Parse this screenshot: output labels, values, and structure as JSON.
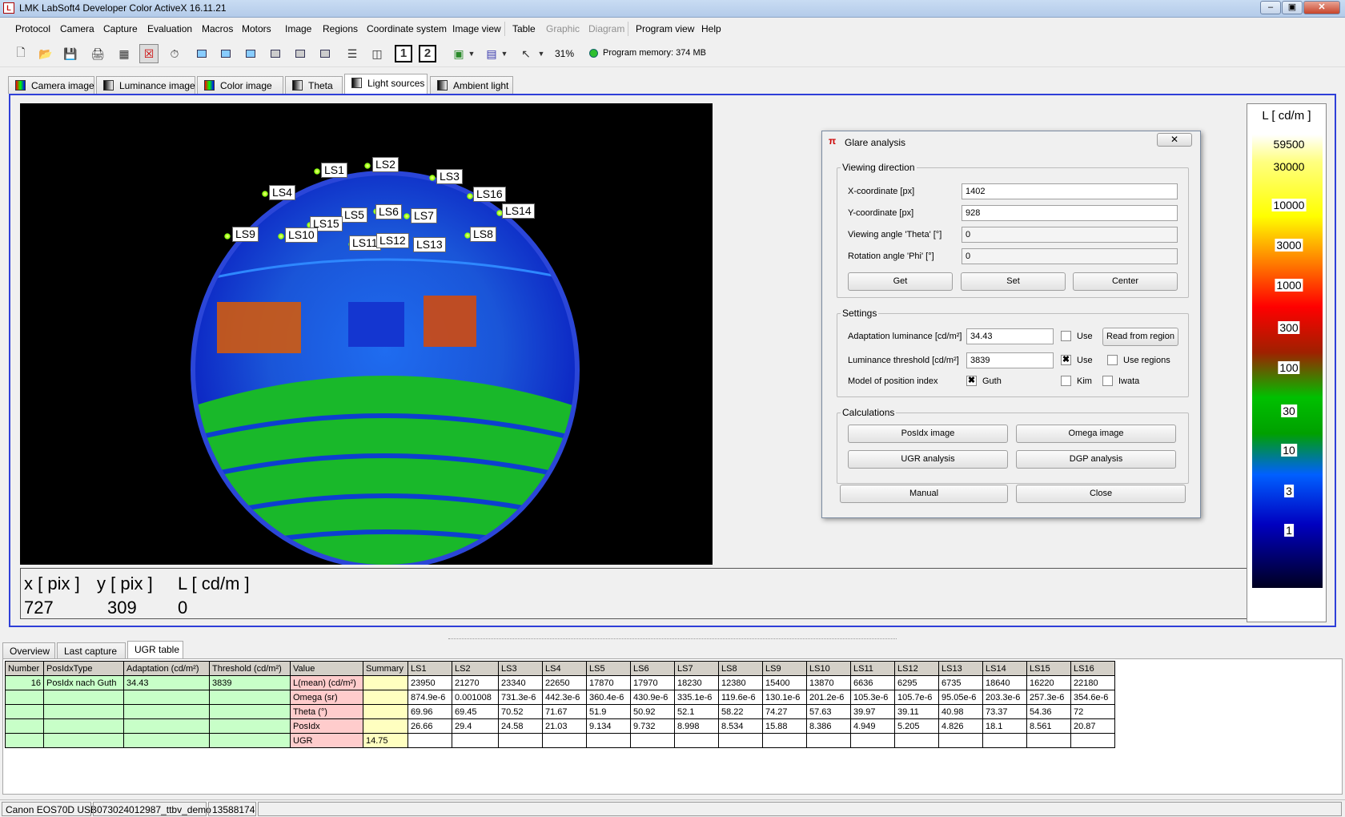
{
  "window": {
    "title": "LMK LabSoft4 Developer Color ActiveX  16.11.21",
    "minimize": "–",
    "restore": "▣",
    "close": "✕"
  },
  "menu": [
    "Protocol",
    "Camera",
    "Capture",
    "Evaluation",
    "Macros",
    "Motors",
    "Image",
    "Regions",
    "Coordinate system",
    "Image view",
    "Table",
    "Graphic",
    "Diagram",
    "Program view",
    "Help"
  ],
  "toolbar": {
    "zoom": "31%",
    "memory": "Program memory: 374 MB",
    "num1": "1",
    "num2": "2"
  },
  "image_tabs": [
    "Camera image",
    "Luminance image",
    "Color image",
    "Theta",
    "Light sources",
    "Ambient light"
  ],
  "light_sources": [
    "LS1",
    "LS2",
    "LS3",
    "LS4",
    "LS16",
    "LS14",
    "LS5",
    "LS6",
    "LS7",
    "LS15",
    "LS9",
    "LS10",
    "LS8",
    "LS11",
    "LS12",
    "LS13"
  ],
  "coords": {
    "x_label": "x [ pix ]",
    "y_label": "y [ pix ]",
    "l_label": "L [ cd/m ]",
    "x": "727",
    "y": "309",
    "l": "0"
  },
  "legend": {
    "title": "L [ cd/m ]",
    "ticks": [
      "59500",
      "30000",
      "10000",
      "3000",
      "1000",
      "300",
      "100",
      "30",
      "10",
      "3",
      "1"
    ]
  },
  "dialog": {
    "title": "Glare analysis",
    "close_x": "✕",
    "viewing_group": "Viewing direction",
    "x_label": "X-coordinate [px]",
    "x_value": "1402",
    "y_label": "Y-coordinate [px]",
    "y_value": "928",
    "theta_label": "Viewing angle 'Theta' [°]",
    "theta_value": "0",
    "phi_label": "Rotation angle 'Phi' [°]",
    "phi_value": "0",
    "get": "Get",
    "set": "Set",
    "center": "Center",
    "settings_group": "Settings",
    "adapt_label": "Adaptation luminance [cd/m²]",
    "adapt_value": "34.43",
    "use1": "Use",
    "read_region": "Read from region",
    "thresh_label": "Luminance threshold [cd/m²]",
    "thresh_value": "3839",
    "use2": "Use",
    "use_regions": "Use regions",
    "model_label": "Model of position index",
    "guth": "Guth",
    "kim": "Kim",
    "iwata": "Iwata",
    "calc_group": "Calculations",
    "posidx_img": "PosIdx image",
    "omega_img": "Omega image",
    "ugr_analysis": "UGR analysis",
    "dgp_analysis": "DGP analysis",
    "manual": "Manual",
    "close": "Close"
  },
  "bottom_tabs": [
    "Overview",
    "Last capture",
    "UGR table"
  ],
  "ugr_table": {
    "headers": [
      "Number",
      "PosIdxType",
      "Adaptation (cd/m²)",
      "Threshold (cd/m²)",
      "Value",
      "Summary",
      "LS1",
      "LS2",
      "LS3",
      "LS4",
      "LS5",
      "LS6",
      "LS7",
      "LS8",
      "LS9",
      "LS10",
      "LS11",
      "LS12",
      "LS13",
      "LS14",
      "LS15",
      "LS16"
    ],
    "rows": [
      [
        "16",
        "PosIdx nach Guth",
        "34.43",
        "3839",
        "L(mean) (cd/m²)",
        "",
        "23950",
        "21270",
        "23340",
        "22650",
        "17870",
        "17970",
        "18230",
        "12380",
        "15400",
        "13870",
        "6636",
        "6295",
        "6735",
        "18640",
        "16220",
        "22180"
      ],
      [
        "",
        "",
        "",
        "",
        "Omega (sr)",
        "",
        "874.9e-6",
        "0.001008",
        "731.3e-6",
        "442.3e-6",
        "360.4e-6",
        "430.9e-6",
        "335.1e-6",
        "119.6e-6",
        "130.1e-6",
        "201.2e-6",
        "105.3e-6",
        "105.7e-6",
        "95.05e-6",
        "203.3e-6",
        "257.3e-6",
        "354.6e-6"
      ],
      [
        "",
        "",
        "",
        "",
        "Theta (°)",
        "",
        "69.96",
        "69.45",
        "70.52",
        "71.67",
        "51.9",
        "50.92",
        "52.1",
        "58.22",
        "74.27",
        "57.63",
        "39.97",
        "39.11",
        "40.98",
        "73.37",
        "54.36",
        "72"
      ],
      [
        "",
        "",
        "",
        "",
        "PosIdx",
        "",
        "26.66",
        "29.4",
        "24.58",
        "21.03",
        "9.134",
        "9.732",
        "8.998",
        "8.534",
        "15.88",
        "8.386",
        "4.949",
        "5.205",
        "4.826",
        "18.1",
        "8.561",
        "20.87"
      ],
      [
        "",
        "",
        "",
        "",
        "UGR",
        "14.75",
        "",
        "",
        "",
        "",
        "",
        "",
        "",
        "",
        "",
        "",
        "",
        "",
        "",
        "",
        "",
        ""
      ]
    ]
  },
  "status": [
    "Canon EOS70D USB",
    "073024012987_ttbv_demo",
    "13588174"
  ]
}
